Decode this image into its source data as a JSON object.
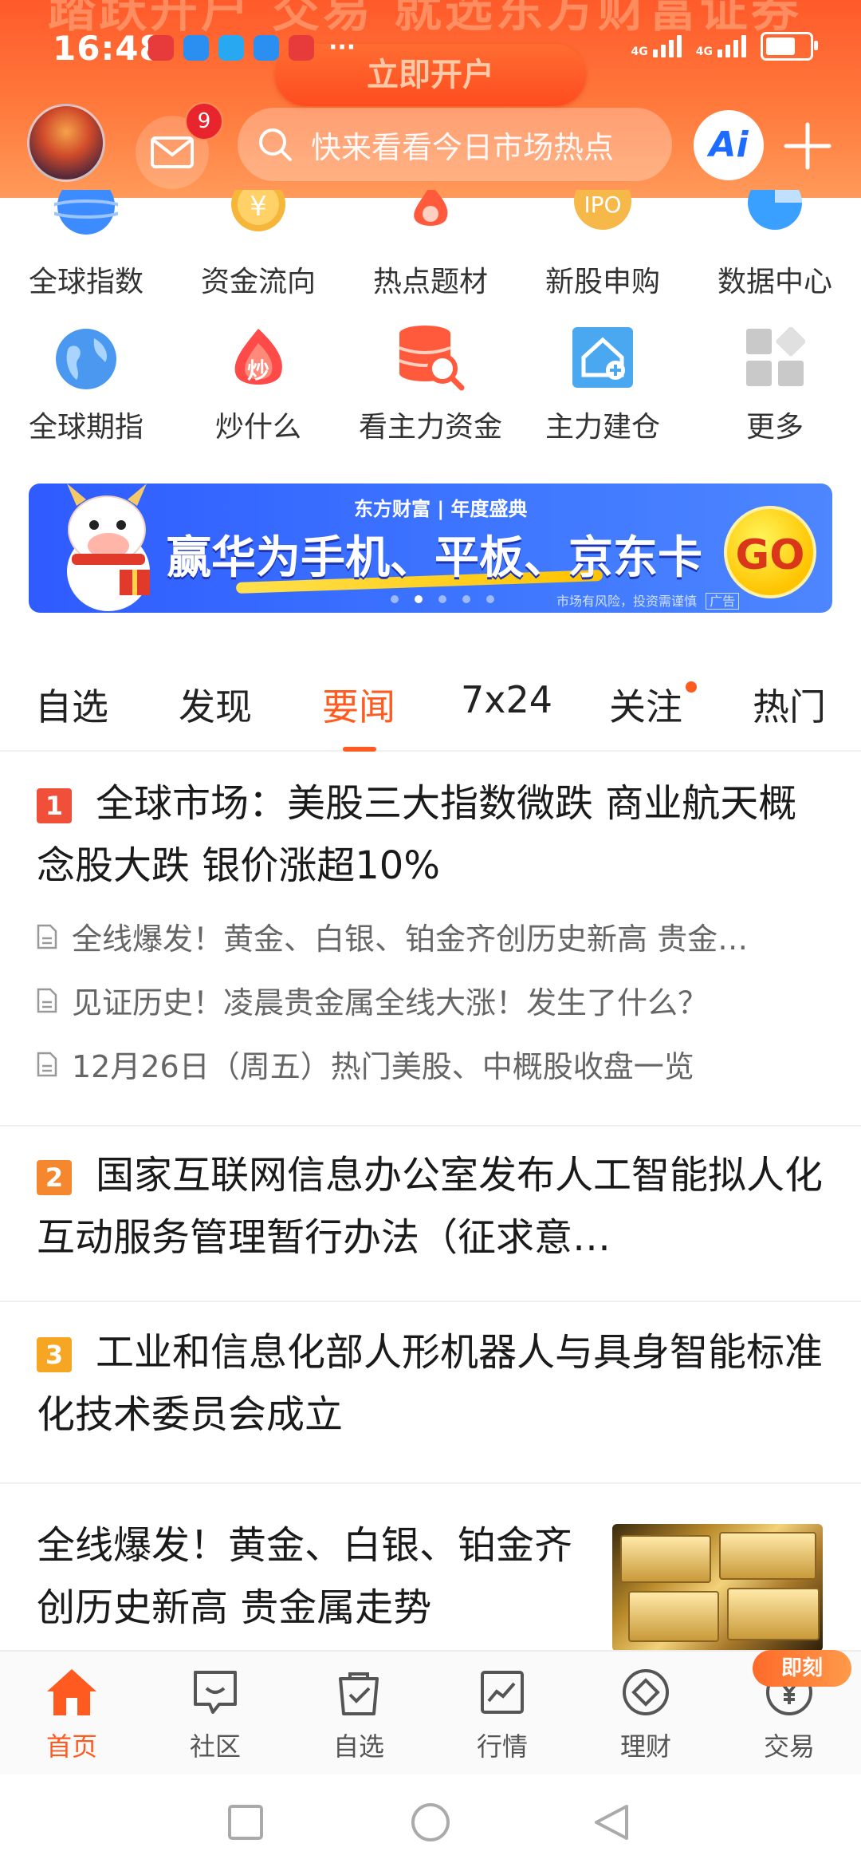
{
  "status_bar": {
    "time": "16:48",
    "network_1": "4G",
    "network_2": "4G",
    "more": "···",
    "battery_level": 0.7
  },
  "header": {
    "bg_promo_text": "踏跃开户 交易 就选东方财富证券",
    "open_account_label": "立即开户",
    "mail_badge": "9",
    "search_placeholder": "快来看看今日市场热点",
    "ai_label": "Ai"
  },
  "grid": {
    "row1": [
      {
        "label": "全球指数",
        "icon": "globe-index-icon"
      },
      {
        "label": "资金流向",
        "icon": "yen-coin-icon"
      },
      {
        "label": "热点题材",
        "icon": "flame-drop-icon"
      },
      {
        "label": "新股申购",
        "icon": "ipo-icon",
        "icon_text": "IPO"
      },
      {
        "label": "数据中心",
        "icon": "pie-chart-icon"
      }
    ],
    "row2": [
      {
        "label": "全球期指",
        "icon": "earth-icon"
      },
      {
        "label": "炒什么",
        "icon": "fire-badge-icon",
        "icon_text": "炒"
      },
      {
        "label": "看主力资金",
        "icon": "database-search-icon"
      },
      {
        "label": "主力建仓",
        "icon": "house-plus-icon"
      },
      {
        "label": "更多",
        "icon": "more-grid-icon"
      }
    ]
  },
  "banner": {
    "brand": "东方财富 | 年度盛典",
    "headline": "赢华为手机、平板、京东卡",
    "go_label": "GO",
    "note": "市场有风险，投资需谨慎",
    "ad_tag": "广告",
    "page_count": 5,
    "active_page": 2
  },
  "tabs": [
    {
      "label": "自选"
    },
    {
      "label": "发现"
    },
    {
      "label": "要闻",
      "active": true
    },
    {
      "label": "7x24"
    },
    {
      "label": "关注",
      "dot": true
    },
    {
      "label": "热门"
    }
  ],
  "news": {
    "item1": {
      "rank": "1",
      "title": "全球市场：美股三大指数微跌 商业航天概念股大跌 银价涨超10%",
      "subs": [
        "全线爆发！黄金、白银、铂金齐创历史新高 贵金…",
        "见证历史！凌晨贵金属全线大涨！发生了什么？",
        "12月26日（周五）热门美股、中概股收盘一览"
      ]
    },
    "item2": {
      "rank": "2",
      "title": "国家互联网信息办公室发布人工智能拟人化互动服务管理暂行办法（征求意…"
    },
    "item3": {
      "rank": "3",
      "title": "工业和信息化部人形机器人与具身智能标准化技术委员会成立"
    },
    "item4": {
      "title": "全线爆发！黄金、白银、铂金齐创历史新高 贵金属走势"
    }
  },
  "bottom_nav": [
    {
      "label": "首页",
      "active": true
    },
    {
      "label": "社区"
    },
    {
      "label": "自选"
    },
    {
      "label": "行情"
    },
    {
      "label": "理财"
    },
    {
      "label": "交易"
    }
  ],
  "trade_badge": "即刻",
  "colors": {
    "accent": "#ff5a1f",
    "rank1": "#f0503a",
    "rank2": "#f5872f",
    "rank3": "#f6a623",
    "banner_blue": "#3d75ff"
  }
}
